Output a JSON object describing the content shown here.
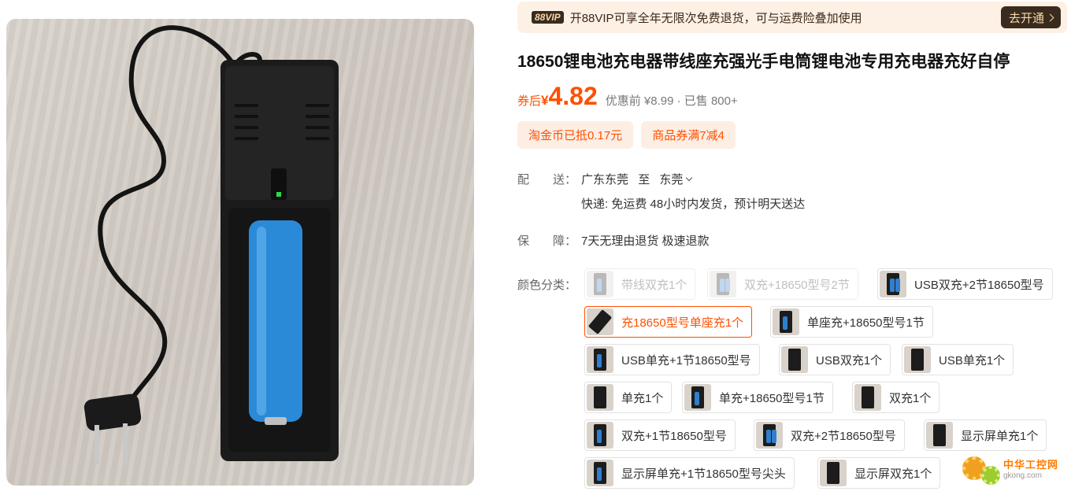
{
  "vip_bar": {
    "badge": "88VIP",
    "text": "开88VIP可享全年无限次免费退货，可与运费险叠加使用",
    "button": "去开通"
  },
  "product": {
    "title": "18650锂电池充电器带线座充强光手电筒锂电池专用充电器充好自停",
    "price_prefix": "券后",
    "currency": "¥",
    "price": "4.82",
    "meta": "优惠前 ¥8.99 · 已售 800+"
  },
  "coupons": [
    "淘金币已抵0.17元",
    "商品券满7减4"
  ],
  "shipping": {
    "label": "配　　送：",
    "from": "广东东莞",
    "to_word": "至",
    "to": "东莞",
    "detail": "快递: 免运费  48小时内发货，预计明天送达"
  },
  "guarantee": {
    "label": "保　　障：",
    "text": "7天无理由退货 极速退款"
  },
  "sku": {
    "label": "颜色分类：",
    "options": [
      {
        "label": "带线双充1个",
        "state": "disabled"
      },
      {
        "label": "双充+18650型号2节",
        "state": "disabled"
      },
      {
        "label": "USB双充+2节18650型号",
        "state": "normal"
      },
      {
        "label": "充18650型号单座充1个",
        "state": "selected"
      },
      {
        "label": "单座充+18650型号1节",
        "state": "normal"
      },
      {
        "label": "USB单充+1节18650型号",
        "state": "normal"
      },
      {
        "label": "USB双充1个",
        "state": "normal"
      },
      {
        "label": "USB单充1个",
        "state": "normal"
      },
      {
        "label": "单充1个",
        "state": "normal"
      },
      {
        "label": "单充+18650型号1节",
        "state": "normal"
      },
      {
        "label": "双充1个",
        "state": "normal"
      },
      {
        "label": "双充+1节18650型号",
        "state": "normal"
      },
      {
        "label": "双充+2节18650型号",
        "state": "normal"
      },
      {
        "label": "显示屏单充1个",
        "state": "normal"
      },
      {
        "label": "显示屏单充+1节18650型号尖头",
        "state": "normal"
      },
      {
        "label": "显示屏双充1个",
        "state": "normal"
      }
    ]
  },
  "watermark": {
    "name": "中华工控网",
    "url": "gkong.com"
  },
  "colors": {
    "accent": "#ff5000",
    "vip_bg": "#fdf0e4",
    "vip_dark": "#3a2b1f"
  }
}
